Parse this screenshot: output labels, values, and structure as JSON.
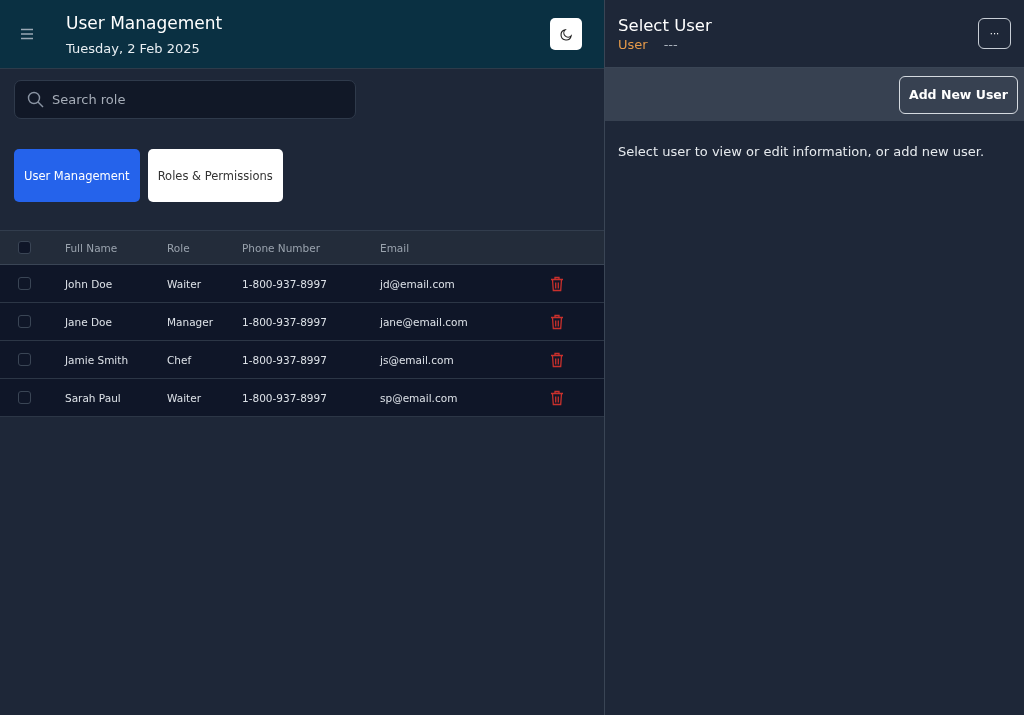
{
  "header": {
    "title": "User Management",
    "date": "Tuesday, 2 Feb 2025"
  },
  "search": {
    "placeholder": "Search role"
  },
  "tabs": [
    {
      "label": "User Management",
      "selected": true
    },
    {
      "label": "Roles & Permissions",
      "selected": false
    }
  ],
  "table": {
    "select_all_checked": false,
    "columns": [
      "Full Name",
      "Role",
      "Phone Number",
      "Email"
    ],
    "rows": [
      {
        "checked": false,
        "cells": [
          "John Doe",
          "Waiter",
          "1-800-937-8997",
          "jd@email.com"
        ]
      },
      {
        "checked": false,
        "cells": [
          "Jane Doe",
          "Manager",
          "1-800-937-8997",
          "jane@email.com"
        ]
      },
      {
        "checked": false,
        "cells": [
          "Jamie Smith",
          "Chef",
          "1-800-937-8997",
          "js@email.com"
        ]
      },
      {
        "checked": false,
        "cells": [
          "Sarah Paul",
          "Waiter",
          "1-800-937-8997",
          "sp@email.com"
        ]
      }
    ]
  },
  "detail": {
    "title": "Select User",
    "label": "User",
    "value": "---",
    "more_button": "···",
    "add_button": "Add New User",
    "message": "Select user to view or edit information, or add new user."
  }
}
